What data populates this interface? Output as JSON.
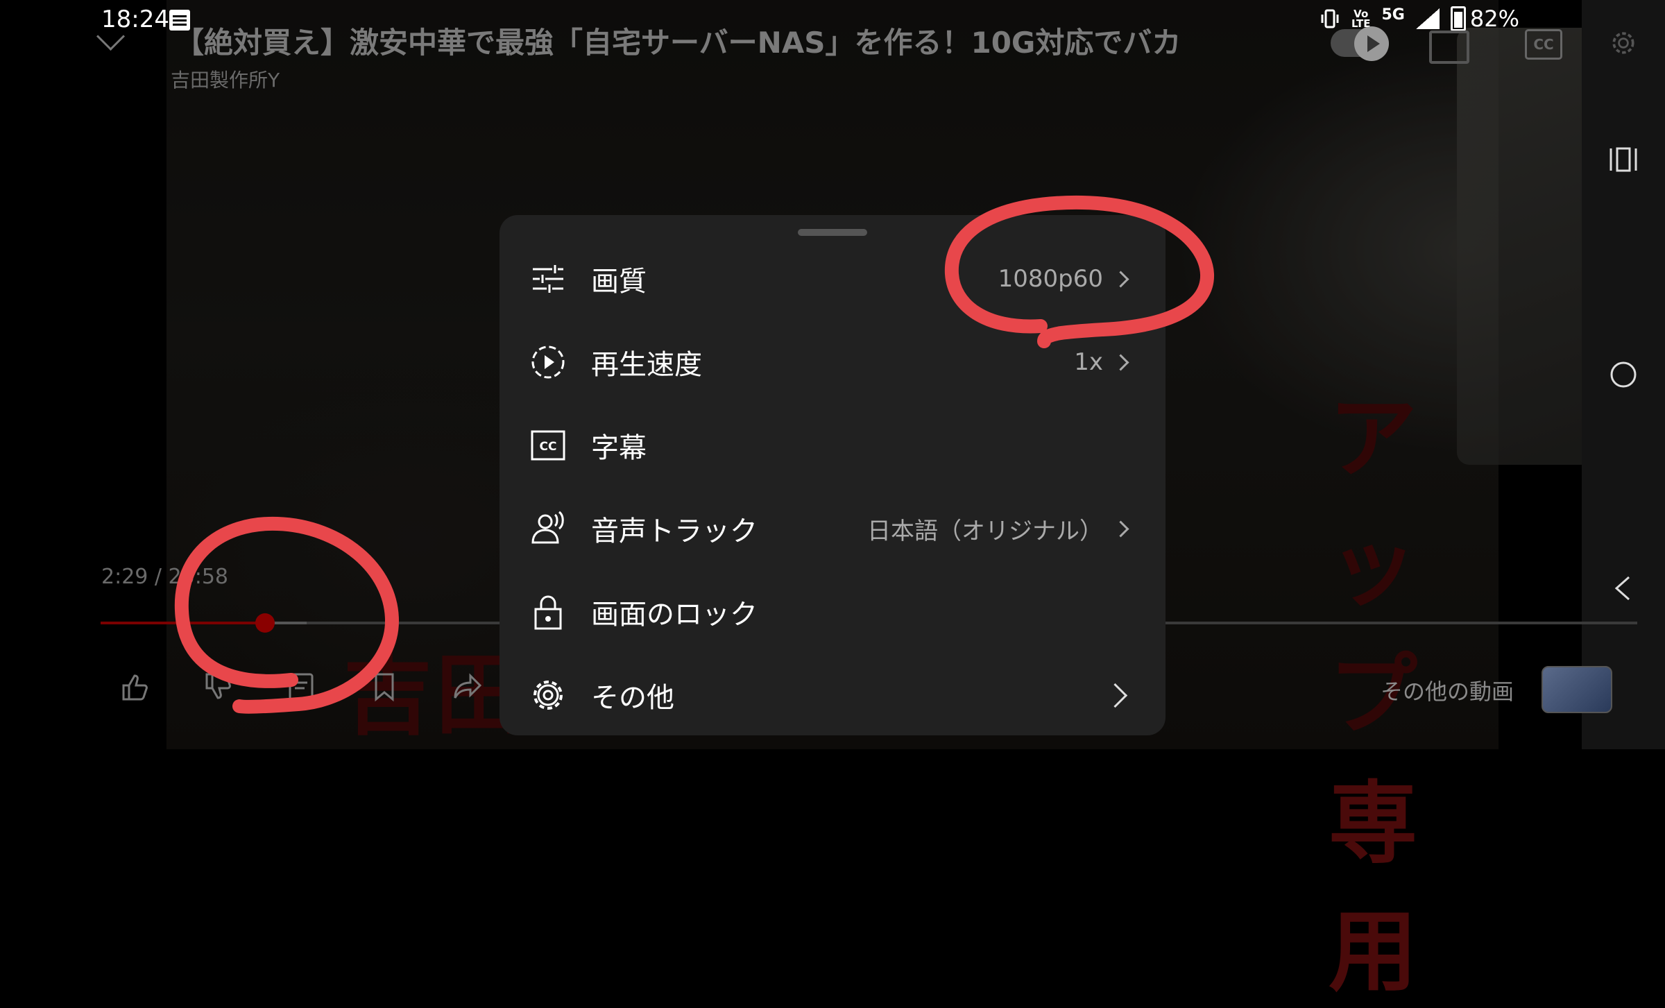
{
  "status_bar": {
    "time": "18:24",
    "volte_label_1": "Vo",
    "volte_label_2": "LTE",
    "network": "5G",
    "battery": "82%"
  },
  "player": {
    "title": "【絶対買え】激安中華で最強「自宅サーバーNAS」を作る！10G対応でバカ",
    "channel": "吉田製作所Y",
    "time_display": "2:29 / 23:58",
    "progress_fraction": 0.104,
    "more_videos_label": "その他の動画",
    "thumbnail_text_left": "吉田製作所マ",
    "thumbnail_text_right": "アップ専用",
    "cc_label": "CC"
  },
  "settings_sheet": {
    "items": [
      {
        "label": "画質",
        "value": "1080p60",
        "icon": "sliders-icon"
      },
      {
        "label": "再生速度",
        "value": "1x",
        "icon": "playback-speed-icon"
      },
      {
        "label": "字幕",
        "value": "",
        "icon": "captions-icon"
      },
      {
        "label": "音声トラック",
        "value": "日本語（オリジナル）",
        "icon": "audio-track-icon"
      },
      {
        "label": "画面のロック",
        "value": "",
        "icon": "lock-icon"
      },
      {
        "label": "その他",
        "value": "",
        "icon": "gear-icon"
      }
    ]
  },
  "colors": {
    "sheet_bg": "#212121",
    "progress_red": "#8a0000",
    "annotation_red": "#e8474b"
  }
}
